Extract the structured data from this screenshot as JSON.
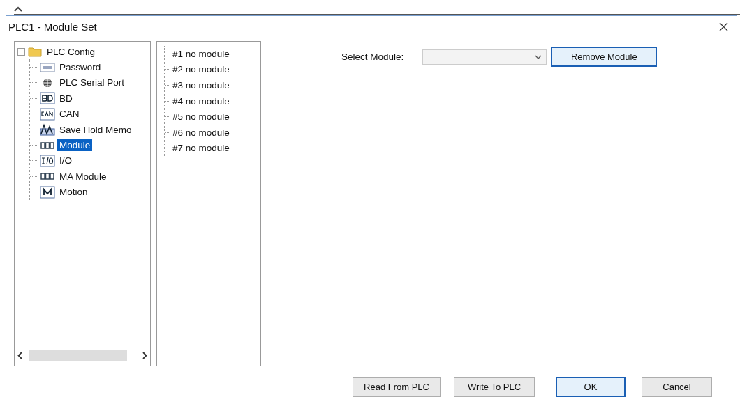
{
  "window": {
    "title": "PLC1 - Module Set"
  },
  "tree": {
    "label": "PLC Config",
    "expanded": true,
    "selected": false,
    "children": [
      {
        "label": "Password",
        "selected": false
      },
      {
        "label": "PLC Serial Port",
        "selected": false
      },
      {
        "label": "BD",
        "selected": false
      },
      {
        "label": "CAN",
        "selected": false
      },
      {
        "label": "Save Hold Memo",
        "selected": false
      },
      {
        "label": "Module",
        "selected": true
      },
      {
        "label": "I/O",
        "selected": false
      },
      {
        "label": "MA Module",
        "selected": false
      },
      {
        "label": "Motion",
        "selected": false
      }
    ]
  },
  "modules": [
    "#1 no module",
    "#2 no module",
    "#3 no module",
    "#4 no module",
    "#5 no module",
    "#6 no module",
    "#7 no module"
  ],
  "select_module": {
    "label": "Select Module:",
    "disabled": true
  },
  "remove_button": {
    "label": "Remove Module",
    "focused": true
  },
  "buttons": [
    {
      "label": "Read From PLC",
      "default": false
    },
    {
      "label": "Write To PLC",
      "default": false
    },
    {
      "label": "OK",
      "default": true
    },
    {
      "label": "Cancel",
      "default": false
    }
  ]
}
